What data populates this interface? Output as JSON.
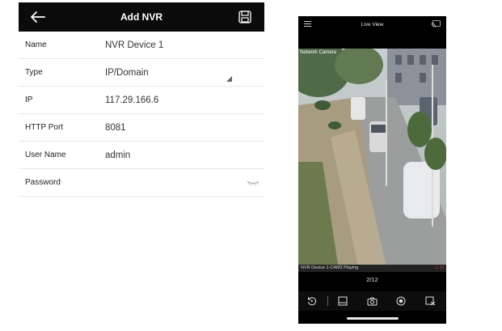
{
  "add_nvr": {
    "title": "Add NVR",
    "fields": [
      {
        "label": "Name",
        "value": "NVR Device 1"
      },
      {
        "label": "Type",
        "value": "IP/Domain"
      },
      {
        "label": "IP",
        "value": "117.29.166.6"
      },
      {
        "label": "HTTP Port",
        "value": "8081"
      },
      {
        "label": "User Name",
        "value": "admin"
      },
      {
        "label": "Password",
        "value": ""
      }
    ],
    "icons": {
      "back": "back-arrow-icon",
      "save": "save-floppy-icon",
      "dropdown": "dropdown-triangle-icon",
      "password_toggle": "eye-closed-icon"
    }
  },
  "live_view": {
    "title": "Live View",
    "camera_overlay": "Network Camera",
    "status": "NVR Device 1-CAM2 Playing",
    "page_indicator": "2/12",
    "icons": {
      "menu": "hamburger-menu-icon",
      "cast": "cast-icon",
      "playback": "playback-icon",
      "layout": "layout-icon",
      "snapshot": "camera-snapshot-icon",
      "record": "record-icon",
      "close": "close-stream-icon"
    }
  }
}
